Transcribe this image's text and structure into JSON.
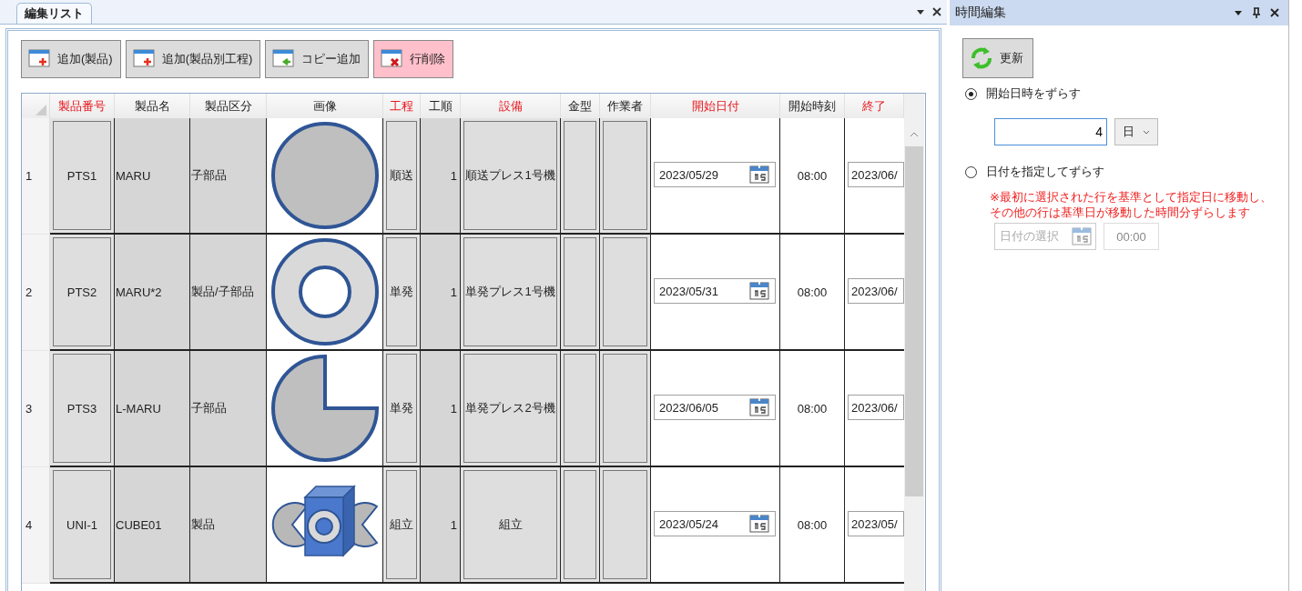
{
  "edit_list": {
    "tab": {
      "label": "編集リスト",
      "selected": true
    },
    "toolbar": [
      {
        "label": "追加(製品)",
        "kind": "add"
      },
      {
        "label": "追加(製品別工程)",
        "kind": "add"
      },
      {
        "label": "コピー追加",
        "kind": "copy"
      },
      {
        "label": "行削除",
        "kind": "delete"
      }
    ],
    "table": {
      "columns": [
        {
          "label": "製品番号",
          "required": true
        },
        {
          "label": "製品名",
          "required": false
        },
        {
          "label": "製品区分",
          "required": false
        },
        {
          "label": "画像",
          "required": false
        },
        {
          "label": "工程",
          "required": true
        },
        {
          "label": "工順",
          "required": false
        },
        {
          "label": "設備",
          "required": true
        },
        {
          "label": "金型",
          "required": false
        },
        {
          "label": "作業者",
          "required": false
        },
        {
          "label": "開始日付",
          "required": true
        },
        {
          "label": "開始時刻",
          "required": false
        },
        {
          "label": "終了",
          "required": true
        }
      ],
      "rows": [
        {
          "row_number": "1",
          "product_no": "PTS1",
          "product_name": "MARU",
          "category": "子部品",
          "kind": "circle",
          "process": "順送",
          "sequence": "1",
          "equipment": "順送プレス1号機",
          "start_date": "2023/05/29",
          "start_time": "08:00",
          "end_date": "2023/06/"
        },
        {
          "row_number": "2",
          "product_no": "PTS2",
          "product_name": "MARU*2",
          "category": "製品/子部品",
          "kind": "ring",
          "process": "単発",
          "sequence": "1",
          "equipment": "単発プレス1号機",
          "start_date": "2023/05/31",
          "start_time": "08:00",
          "end_date": "2023/06/"
        },
        {
          "row_number": "3",
          "product_no": "PTS3",
          "product_name": "L-MARU",
          "category": "子部品",
          "kind": "pie",
          "process": "単発",
          "sequence": "1",
          "equipment": "単発プレス2号機",
          "start_date": "2023/06/05",
          "start_time": "08:00",
          "end_date": "2023/06/"
        },
        {
          "row_number": "4",
          "product_no": "UNI-1",
          "product_name": "CUBE01",
          "category": "製品",
          "kind": "cube",
          "process": "組立",
          "sequence": "1",
          "equipment": "組立",
          "start_date": "2023/05/24",
          "start_time": "08:00",
          "end_date": "2023/05/"
        }
      ]
    }
  },
  "time_edit": {
    "title": "時間編集",
    "refresh_button": "更新",
    "options": [
      {
        "label": "開始日時をずらす",
        "selected": true
      },
      {
        "label": "日付を指定してずらす",
        "selected": false
      }
    ],
    "shift_amount": "4",
    "shift_unit": "日",
    "note": [
      "※最初に選択された行を基準として指定日に移動し、",
      "その他の行は基準日が移動した時間分ずらします"
    ],
    "date_picker": {
      "placeholder": "日付の選択",
      "disabled": true
    },
    "time_field": {
      "value": "00:00",
      "disabled": true
    }
  }
}
